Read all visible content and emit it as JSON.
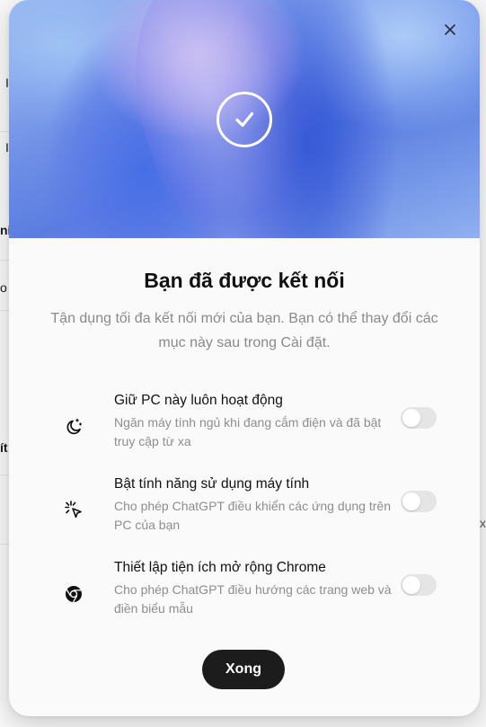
{
  "background": {
    "fragments_left": [
      "I",
      "I",
      "ni",
      "o",
      "ít"
    ],
    "fragment_right": "x"
  },
  "dialog": {
    "close_icon": "close-icon",
    "check_icon": "checkmark-icon",
    "title": "Bạn đã được kết nối",
    "subtitle": "Tận dụng tối đa kết nối mới của bạn. Bạn có thể thay đổi các mục này sau trong Cài đặt.",
    "options": [
      {
        "icon": "sleep-moon-icon",
        "title": "Giữ PC này luôn hoạt động",
        "description": "Ngăn máy tính ngủ khi đang cắm điện và đã bật truy cập từ xa",
        "enabled": false
      },
      {
        "icon": "cursor-click-icon",
        "title": "Bật tính năng sử dụng máy tính",
        "description": "Cho phép ChatGPT điều khiển các ứng dụng trên PC của bạn",
        "enabled": false
      },
      {
        "icon": "chrome-icon",
        "title": "Thiết lập tiện ích mở rộng Chrome",
        "description": "Cho phép ChatGPT điều hướng các trang web và điền biểu mẫu",
        "enabled": false
      }
    ],
    "done_label": "Xong"
  },
  "colors": {
    "hero_blue": "#5a7de0",
    "done_button": "#1c1c1c",
    "toggle_off": "#e5e5e5"
  }
}
